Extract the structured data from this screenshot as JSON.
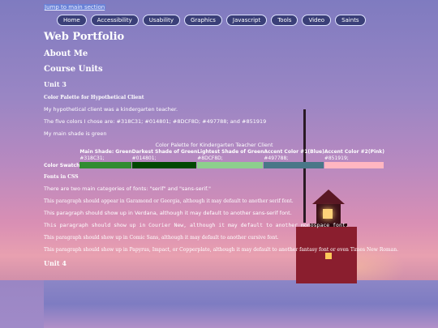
{
  "skip_link": "Jump to main section",
  "nav": [
    "Home",
    "Accessibility",
    "Usability",
    "Graphics",
    "Javascript",
    "Tools",
    "Video",
    "Saints"
  ],
  "page": {
    "title": "Web Portfolio",
    "about_heading": "About Me",
    "units_heading": "Course Units",
    "unit3_heading": "Unit 3",
    "palette_heading": "Color Palette for Hypothetical Client",
    "client_text": "My hypothetical client was a kindergarten teacher.",
    "colors_text": "The five colors I chose are: #318C31; #014801; #8DCF8D; #497788; and #851919",
    "main_shade_text": "My main shade is green",
    "table": {
      "caption": "Color Palette for Kindergarten Teacher Client",
      "headers": [
        "",
        "Main Shade: Green",
        "Darkest Shade of Green",
        "Lightest Shade of Green",
        "Accent Color #1(Blue)",
        "Accent Color #2(Pink)"
      ],
      "codes": [
        "#318C31;",
        "#014801;",
        "#8DCF8D;",
        "#497788;",
        "#851919;"
      ],
      "swatch_label": "Color Swatch",
      "swatch_colors": [
        "#318C31",
        "#014801",
        "#8DCF8D",
        "#497788",
        "#FFB6C1"
      ]
    },
    "fonts_heading": "Fonts in CSS",
    "fonts_intro": "There are two main categories of fonts: \"serif\" and \"sans-serif.\"",
    "font_garamond": "This paragraph should appear in Garamond or Georgia, although it may default to another serif font.",
    "font_verdana": "This paragraph should show up in Verdana, although it may default to another sans-serif font.",
    "font_courier": "This paragraph should show up in Courier New, although it may default to another monospace font.",
    "font_comic": "This paragraph should show up in Comic Sans, although it may default to another cursive font.",
    "font_papyrus": "This paragraph should show up in Papyrus, Impact, or Copperplate, although it may default to another fantasy font or even Times New Roman.",
    "unit4_heading": "Unit 4"
  }
}
